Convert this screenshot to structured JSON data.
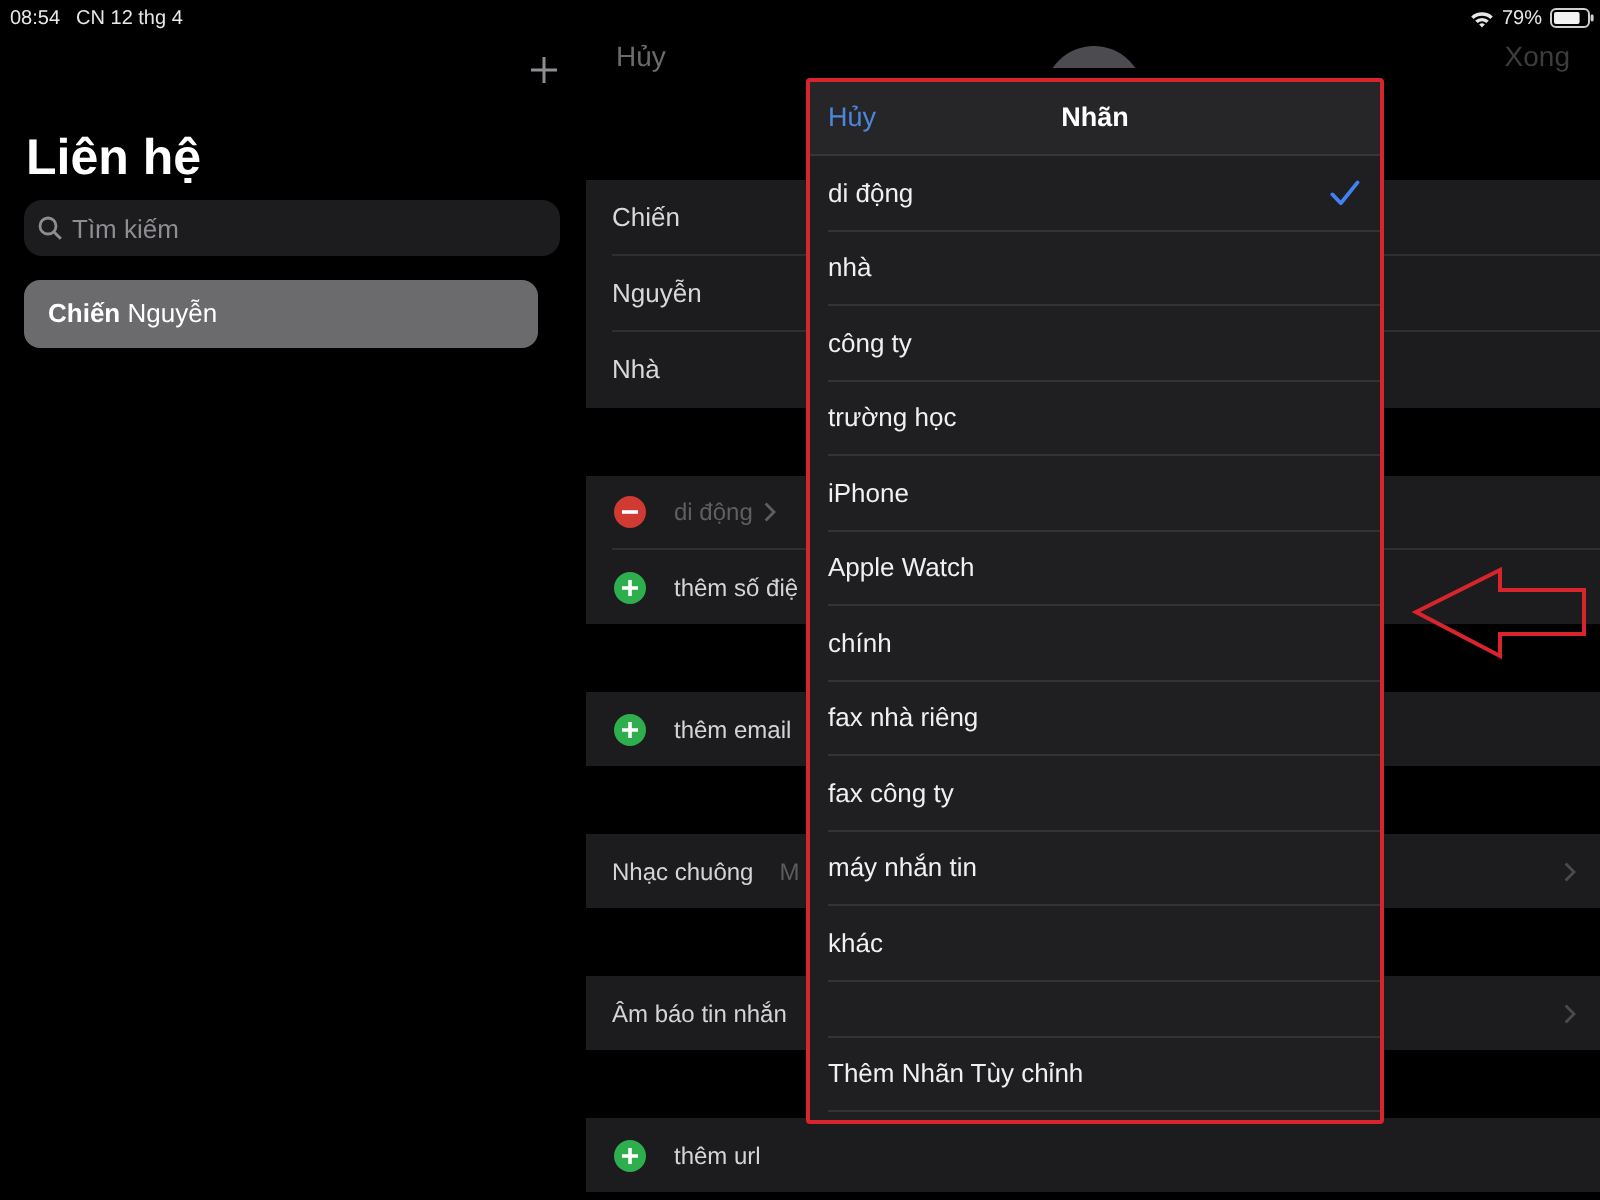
{
  "status_bar": {
    "time": "08:54",
    "date": "CN 12 thg 4",
    "battery": "79%"
  },
  "sidebar": {
    "title": "Liên hệ",
    "search": {
      "placeholder": "Tìm kiếm"
    },
    "contacts": [
      {
        "name": "**Chiến** Nguyễn",
        "selected": true
      }
    ]
  },
  "editor": {
    "cancel": "Hủy",
    "done": {
      "label": "Xong",
      "disabled": true
    },
    "sections": [
      {
        "rows": [
          {
            "kind": "field",
            "value": "Chiến"
          },
          {
            "kind": "field",
            "value": "Nguyễn"
          },
          {
            "kind": "field",
            "value": "Nhà"
          }
        ]
      },
      {
        "rows": [
          {
            "kind": "remove",
            "label": "di động"
          },
          {
            "kind": "add",
            "label": "thêm số điệ"
          }
        ]
      },
      {
        "rows": [
          {
            "kind": "add",
            "label": "thêm email"
          }
        ]
      },
      {
        "rows": [
          {
            "kind": "link",
            "label": "Nhạc chuông",
            "value": "M"
          }
        ]
      },
      {
        "rows": [
          {
            "kind": "link",
            "label": "Âm báo tin nhắn"
          }
        ]
      },
      {
        "rows": [
          {
            "kind": "add",
            "label": "thêm url"
          }
        ]
      }
    ]
  },
  "label_picker": {
    "cancel": "Hủy",
    "title": "Nhãn",
    "highlighted": true,
    "options": [
      {
        "label": "di động",
        "selected": true
      },
      {
        "label": "nhà",
        "selected": false
      },
      {
        "label": "công ty",
        "selected": false
      },
      {
        "label": "trường học",
        "selected": false
      },
      {
        "label": "iPhone",
        "selected": false
      },
      {
        "label": "Apple Watch",
        "selected": false
      },
      {
        "label": "chính",
        "selected": false
      },
      {
        "label": "fax nhà riêng",
        "selected": false
      },
      {
        "label": "fax công ty",
        "selected": false
      },
      {
        "label": "máy nhắn tin",
        "selected": false
      },
      {
        "label": "khác",
        "selected": false
      }
    ],
    "custom_label": "Thêm Nhãn Tùy chỉnh"
  },
  "annotations": [
    {
      "kind": "arrow"
    }
  ]
}
